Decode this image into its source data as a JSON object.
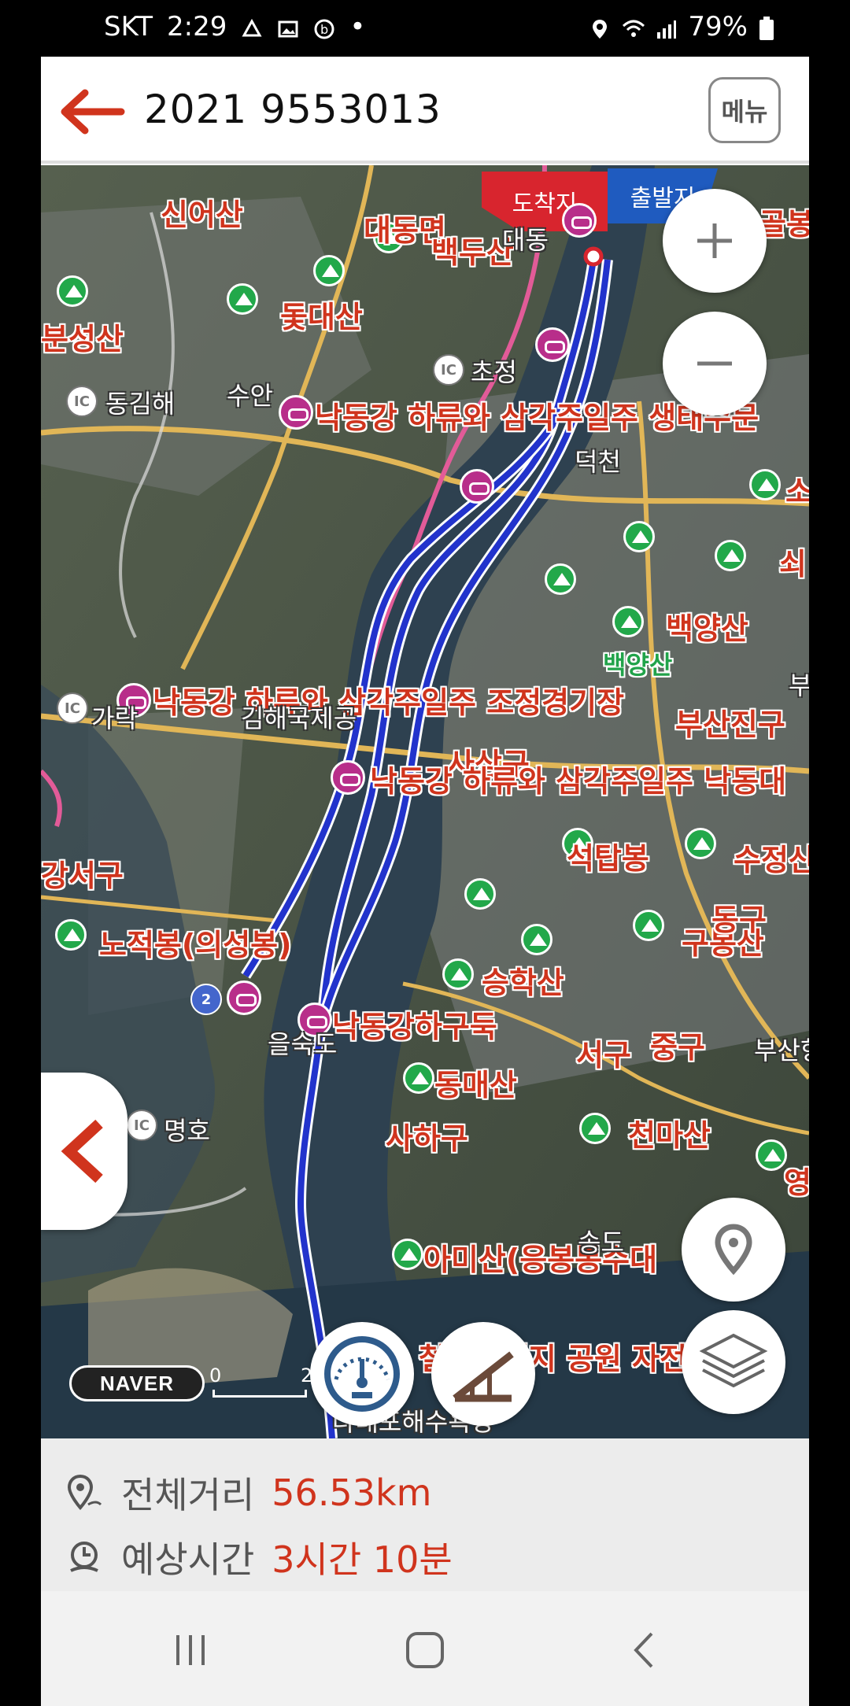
{
  "status_bar": {
    "carrier": "SKT",
    "time": "2:29",
    "battery": "79%"
  },
  "header": {
    "title": "2021 9553013",
    "menu_label": "메뉴"
  },
  "map": {
    "tags": {
      "arrival": "도착지",
      "departure": "출발지"
    },
    "labels": {
      "sinoesan": "신어산",
      "daedongmyeon": "대동면",
      "baekdusan": "백두산",
      "daedong": "대동",
      "bunseongsan": "분성산",
      "otdaesan": "돛대산",
      "dong_gimhae": "동김해",
      "chojeong": "초정",
      "suan": "수안",
      "lower_nakdong_1": "낙동강 하류와 삼각주일주 생태수문",
      "deokcheon": "덕천",
      "baekyangsan": "백양산",
      "baekyangsan_green": "백양산",
      "lower_nakdong_2": "낙동강 하류와 삼각주일주 조정경기장",
      "garak": "가락",
      "gimhae_airport": "김해국제공",
      "busanjingu": "부산진구",
      "sasang": "사상구",
      "lower_nakdong_3": "낙동강 하류와 삼각주일주 낙동대",
      "gangseogu": "강서구",
      "seoktapbong": "석탑봉",
      "sujeongsan": "수정산",
      "nojeokbong": "노적봉(의성봉)",
      "gubongsan": "구봉산",
      "donggu": "동구",
      "seunghaksan": "승학산",
      "nakdong_estuary": "낙동강하구둑",
      "eulsukdo": "을숙도",
      "seogu": "서구",
      "junggu": "중구",
      "busan_port": "부산항",
      "dongmaesan": "동매산",
      "myeongho": "명호",
      "sahagu": "사하구",
      "cheonmasan": "천마산",
      "amisan": "아미산(응봉봉수대",
      "songdo": "송도",
      "bike_park": "철새도래지 공원 자전거 도",
      "dadaepo": "다대포해수욕장",
      "ic": "IC",
      "route_no": "2",
      "right_edge_1": "골봉",
      "right_edge_2": "소",
      "right_edge_3": "쇠",
      "right_edge_4": "부",
      "right_edge_5": "영"
    },
    "attribution": "NAVER",
    "scale": {
      "start": "0",
      "end": "2"
    }
  },
  "info": {
    "distance_label": "전체거리",
    "distance_value": "56.53km",
    "time_label": "예상시간",
    "time_value": "3시간 10분"
  },
  "colors": {
    "accent": "#d0341d",
    "route": "#2233cc",
    "bike_marker": "#b82e8a",
    "mountain_marker": "#22a84a"
  }
}
